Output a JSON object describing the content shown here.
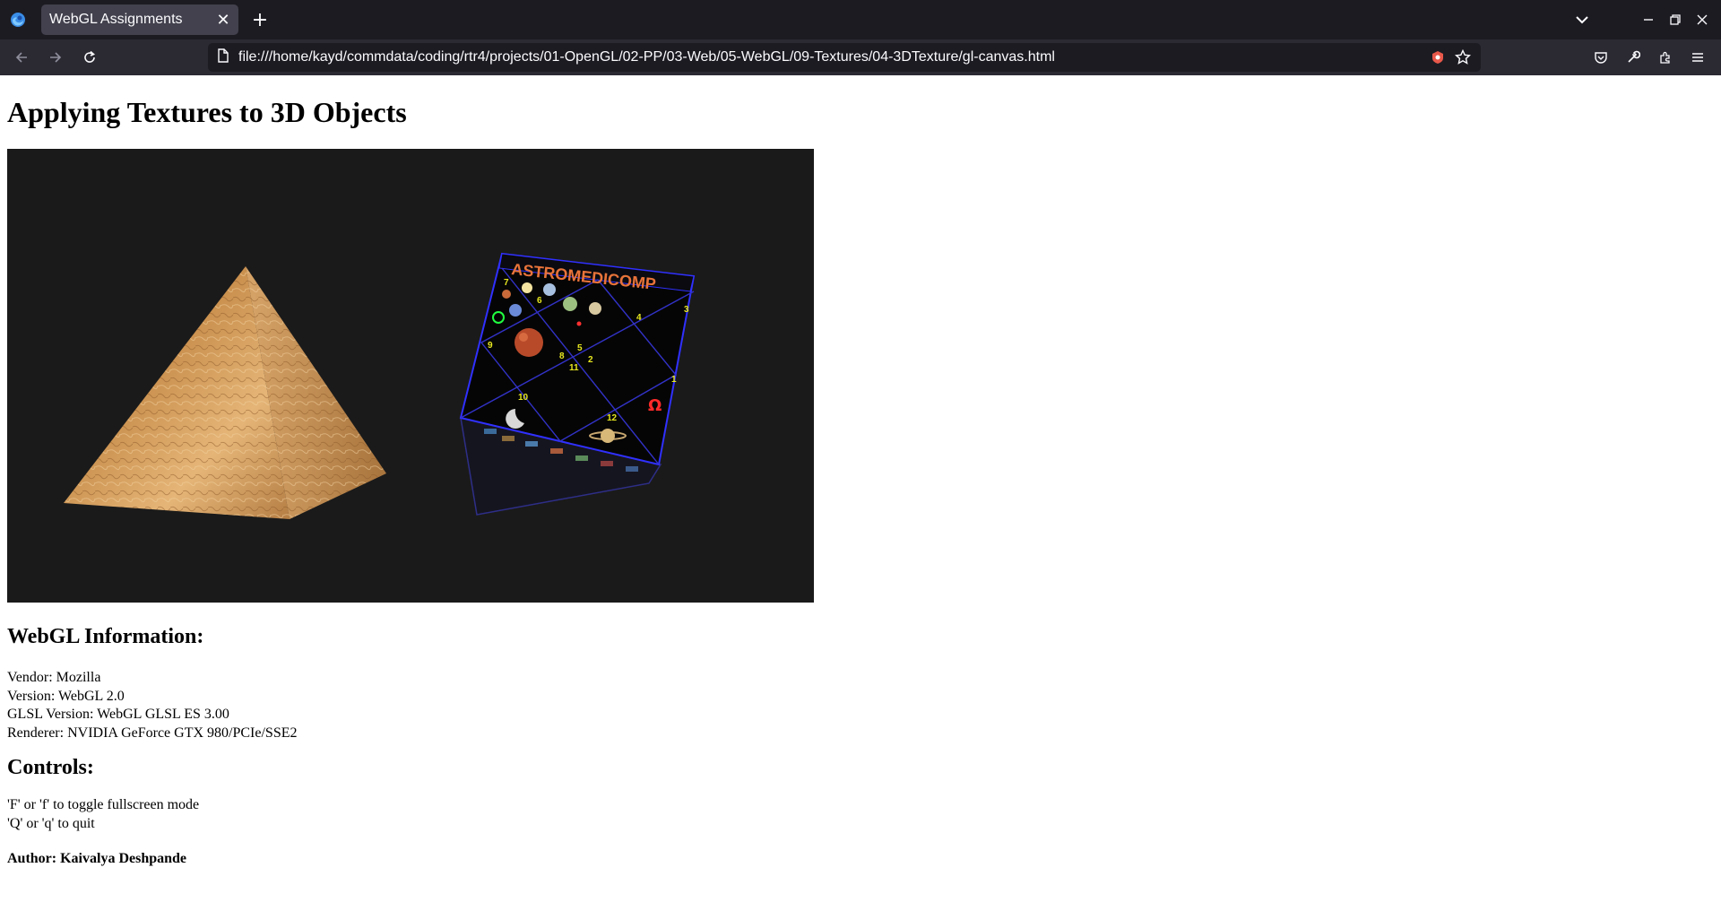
{
  "browser": {
    "tab_title": "WebGL Assignments",
    "url": "file:///home/kayd/commdata/coding/rtr4/projects/01-OpenGL/02-PP/03-Web/05-WebGL/09-Textures/04-3DTexture/gl-canvas.html",
    "accent_color": "#1c1b22"
  },
  "page": {
    "title": "Applying Textures to 3D Objects",
    "cube_label": "ASTROMEDICOMP",
    "cube_numbers": [
      "7",
      "6",
      "4",
      "3",
      "9",
      "8",
      "5",
      "2",
      "11",
      "1",
      "10",
      "12"
    ],
    "webgl_heading": "WebGL Information:",
    "info": [
      "Vendor: Mozilla",
      "Version: WebGL 2.0",
      "GLSL Version: WebGL GLSL ES 3.00",
      "Renderer: NVIDIA GeForce GTX 980/PCIe/SSE2"
    ],
    "controls_heading": "Controls:",
    "controls": [
      "'F' or 'f' to toggle fullscreen mode",
      "'Q' or 'q' to quit"
    ],
    "author": "Author: Kaivalya Deshpande"
  }
}
